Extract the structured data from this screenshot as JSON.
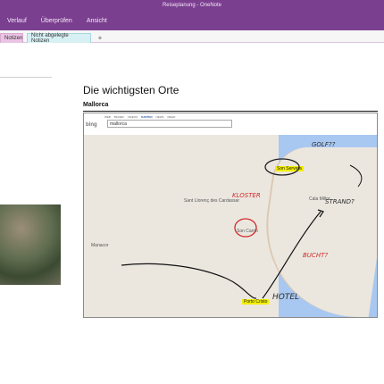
{
  "window": {
    "title": "Reiseplanung - OneNote"
  },
  "ribbon": {
    "tabs": [
      "Verlauf",
      "Überprüfen",
      "Ansicht"
    ]
  },
  "notebook_tabs": [
    {
      "label": "Notizen"
    },
    {
      "label": "Nicht abgelegte Notizen"
    },
    {
      "label": "+"
    }
  ],
  "page": {
    "title": "Die wichtigsten Orte",
    "section": "Mallorca"
  },
  "map": {
    "search": "mallorca",
    "nav": [
      "WEB",
      "BILDER",
      "VIDEOS",
      "KARTEN",
      "NEWS",
      "MEHR"
    ],
    "places": [
      "Manacor",
      "Sant Llorenç des Cardassar",
      "Son Servera",
      "Cala Millor",
      "Porto Cristo",
      "Son Carrió"
    ],
    "annotations": [
      "GOLF??",
      "KLOSTER",
      "STRAND?",
      "BUCHT?",
      "HOTEL"
    ]
  }
}
